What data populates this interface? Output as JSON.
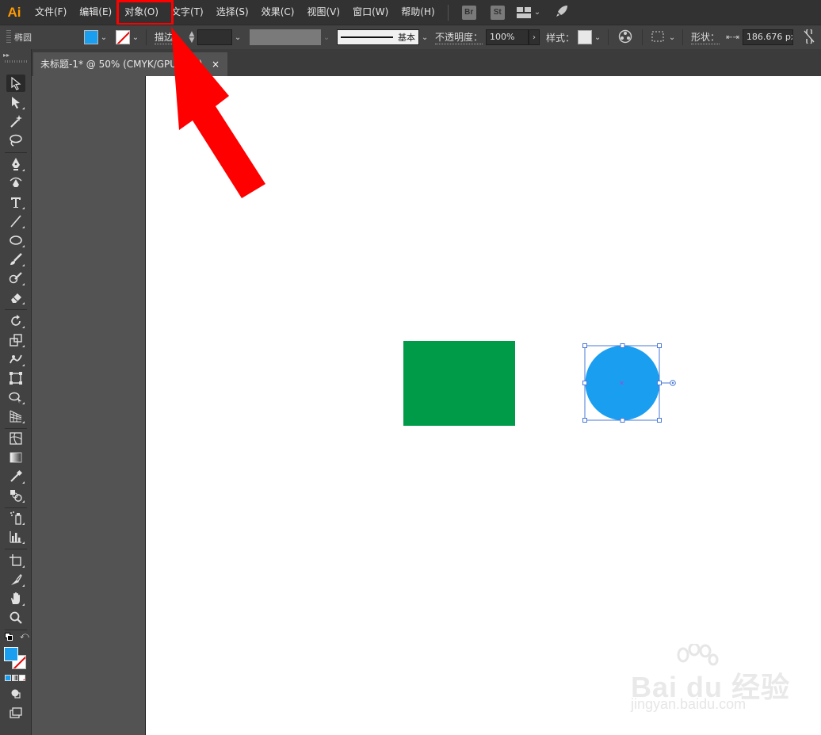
{
  "app": {
    "logo": "Ai"
  },
  "menu": [
    "文件(F)",
    "编辑(E)",
    "对象(O)",
    "文字(T)",
    "选择(S)",
    "效果(C)",
    "视图(V)",
    "窗口(W)",
    "帮助(H)"
  ],
  "menubar_icons": {
    "bridge": "Br",
    "stock": "St"
  },
  "controlbar": {
    "selection_type": "椭圆",
    "fill_color": "#1a9ff0",
    "stroke_label": "描边：",
    "stroke_profile": "基本",
    "opacity_label": "不透明度：",
    "opacity_value": "100%",
    "style_label": "样式：",
    "shape_label": "形状：",
    "width_value": "186.676 px"
  },
  "document_tab": {
    "title": "未标题-1* @ 50% (CMYK/GPU 预览)",
    "close": "×"
  },
  "artwork": {
    "rectangle_color": "#009b48",
    "circle_color": "#1a9ff0",
    "selection_color": "#4a78d8"
  },
  "annotation": {
    "highlight_color": "#ff0000",
    "arrow_color": "#ff0000"
  },
  "watermark": {
    "brand": "Bai du 经验",
    "url": "jingyan.baidu.com"
  }
}
